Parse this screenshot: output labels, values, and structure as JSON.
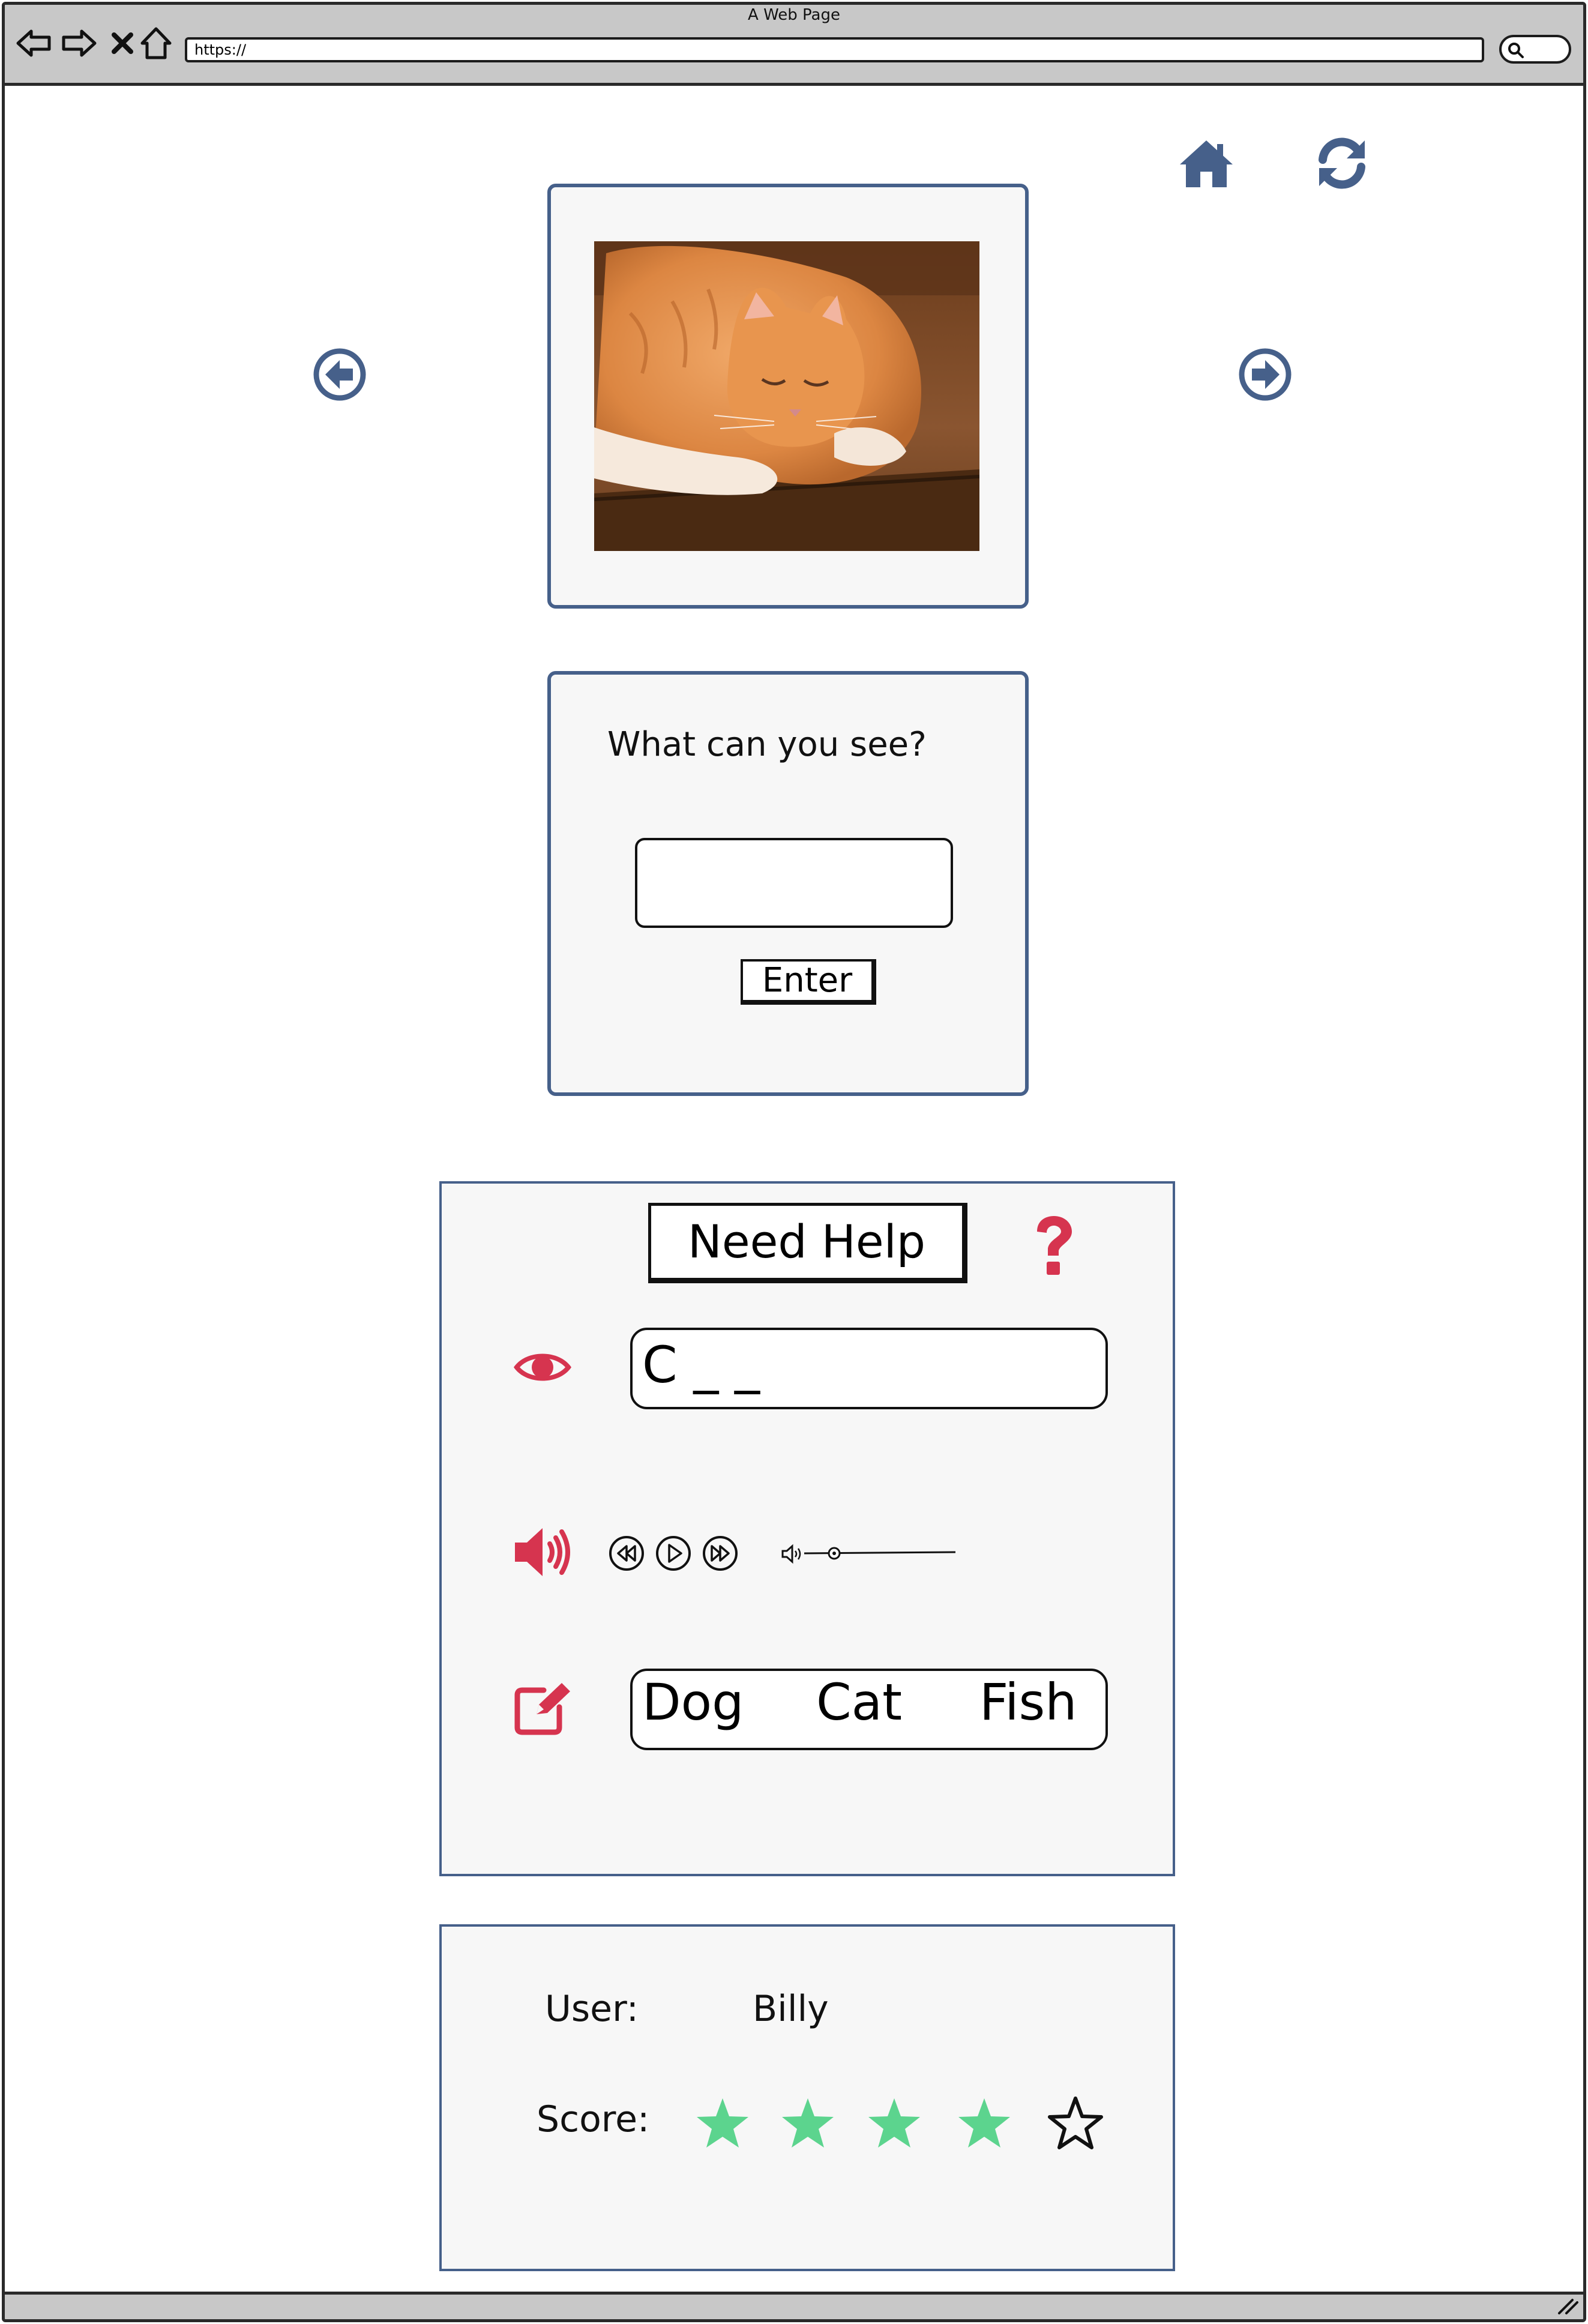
{
  "window": {
    "title": "A Web Page",
    "url": "https://"
  },
  "icons": {
    "back": "back-arrow-icon",
    "forward": "forward-arrow-icon",
    "stop": "close-icon",
    "browser_home": "home-outline-icon",
    "search": "search-icon",
    "home": "home-icon",
    "refresh": "refresh-icon",
    "prev": "circle-arrow-left-icon",
    "next": "circle-arrow-right-icon",
    "help": "question-mark-icon",
    "hint": "eye-icon",
    "audio": "speaker-icon",
    "choices": "edit-icon"
  },
  "colors": {
    "accent": "#46608a",
    "help": "#d6344f",
    "star": "#5cd48e"
  },
  "question": {
    "prompt": "What can you see?",
    "input_value": "",
    "enter_label": "Enter"
  },
  "help": {
    "button_label": "Need Help",
    "hint": "C _ _",
    "choices": [
      "Dog",
      "Cat",
      "Fish"
    ]
  },
  "user": {
    "user_label": "User:",
    "name": "Billy",
    "score_label": "Score:",
    "score": 4,
    "max_score": 5
  }
}
